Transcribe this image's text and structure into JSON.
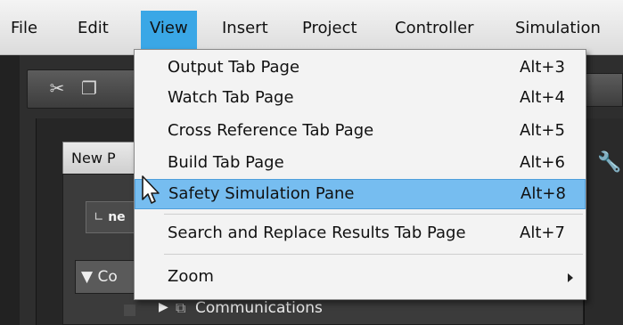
{
  "menubar": {
    "items": [
      "File",
      "Edit",
      "View",
      "Insert",
      "Project",
      "Controller",
      "Simulation"
    ],
    "active": "View"
  },
  "view_menu": {
    "items": [
      {
        "label": "Output Tab Page",
        "shortcut": "Alt+3"
      },
      {
        "label": "Watch Tab Page",
        "shortcut": "Alt+4"
      },
      {
        "label": "Cross Reference Tab Page",
        "shortcut": "Alt+5"
      },
      {
        "label": "Build Tab Page",
        "shortcut": "Alt+6"
      },
      {
        "label": "Safety Simulation Pane",
        "shortcut": "Alt+8",
        "highlighted": true
      },
      {
        "label": "Search and Replace Results Tab Page",
        "shortcut": "Alt+7"
      },
      {
        "label": "Zoom",
        "has_submenu": true
      }
    ]
  },
  "background": {
    "panel_tab_label": "New P",
    "input_text": "ne",
    "tree_top_label": "Co",
    "tree_item_label": "Communications"
  },
  "colors": {
    "menu_active": "#3aa7e6",
    "item_highlight": "#76bdf0"
  }
}
